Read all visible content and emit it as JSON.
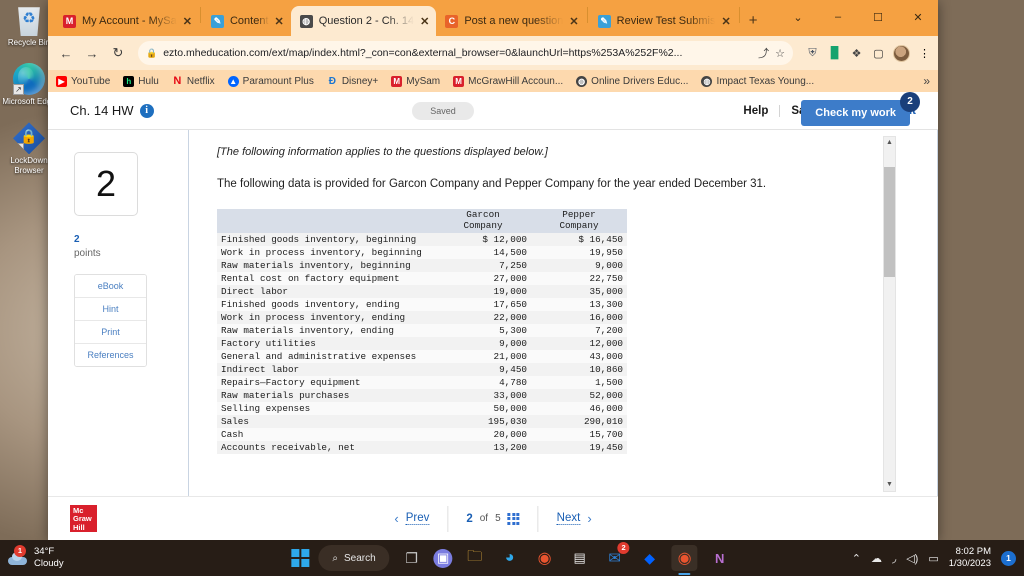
{
  "desktop": {
    "icons": [
      {
        "name": "recycle-bin",
        "label": "Recycle Bin"
      },
      {
        "name": "microsoft-edge",
        "label": "Microsoft Edge"
      },
      {
        "name": "lockdown-browser",
        "label": "LockDown Browser"
      }
    ]
  },
  "browser": {
    "tabs": [
      {
        "title": "My Account - MySa",
        "favicon": "M",
        "favicon_color": "#d9202c",
        "active": false
      },
      {
        "title": "Content",
        "favicon": "✎",
        "favicon_color": "#3aa0d8",
        "active": false
      },
      {
        "title": "Question 2 - Ch. 14",
        "favicon": "⊕",
        "favicon_color": "#4a4a4a",
        "active": true
      },
      {
        "title": "Post a new question",
        "favicon": "C",
        "favicon_color": "#e8632a",
        "active": false
      },
      {
        "title": "Review Test Submis",
        "favicon": "✎",
        "favicon_color": "#3aa0d8",
        "active": false
      }
    ],
    "new_tab_label": "+",
    "window_controls": {
      "restore": "⌄",
      "minimize": "–",
      "maximize": "☐",
      "close": "✕"
    },
    "nav": {
      "back": "←",
      "forward": "→",
      "reload": "↻"
    },
    "omnibox": {
      "lock": "🔒",
      "url": "ezto.mheducation.com/ext/map/index.html?_con=con&external_browser=0&launchUrl=https%253A%252F%2...",
      "share_icon": "⤴",
      "bookmark_star": "☆"
    },
    "extensions": [
      {
        "name": "shield-extension-icon",
        "glyph": "⛨",
        "color": "#4b5563"
      },
      {
        "name": "grammarly-extension-icon",
        "glyph": "▐▌",
        "color": "#15a36e"
      },
      {
        "name": "puzzle-extensions-icon",
        "glyph": "🧩",
        "color": "#444"
      },
      {
        "name": "sidebar-extension-icon",
        "glyph": "◯",
        "color": "#333"
      }
    ],
    "menu_icon": "⋮",
    "bookmarks": [
      {
        "label": "YouTube",
        "mark": "▶",
        "color": "#ff0000"
      },
      {
        "label": "Hulu",
        "mark": "h",
        "color": "#1ce783"
      },
      {
        "label": "Netflix",
        "mark": "N",
        "color": "#e50914"
      },
      {
        "label": "Paramount Plus",
        "mark": "▲",
        "color": "#0064ff"
      },
      {
        "label": "Disney+",
        "mark": "D",
        "color": "#1a75d1"
      },
      {
        "label": "MySam",
        "mark": "M",
        "color": "#d9202c"
      },
      {
        "label": "McGrawHill Accoun...",
        "mark": "M",
        "color": "#d9202c"
      },
      {
        "label": "Online Drivers Educ...",
        "mark": "⊕",
        "color": "#444"
      },
      {
        "label": "Impact Texas Young...",
        "mark": "⊕",
        "color": "#444"
      }
    ],
    "bookmarks_overflow": "»"
  },
  "assignment": {
    "title": "Ch. 14 HW",
    "info_icon_label": "i",
    "save_status": "Saved",
    "actions": [
      {
        "label": "Help"
      },
      {
        "label": "Save & Exit"
      },
      {
        "label": "Submit"
      }
    ],
    "check_my_work": {
      "label": "Check my work",
      "badge": "2"
    }
  },
  "question": {
    "number": "2",
    "points_value": "2",
    "points_label": "points",
    "side_buttons": [
      "eBook",
      "Hint",
      "Print",
      "References"
    ],
    "intro_italic": "[The following information applies to the questions displayed below.]",
    "intro_text": "The following data is provided for Garcon Company and Pepper Company for the year ended December 31."
  },
  "table": {
    "columns": [
      {
        "line1": "Garcon",
        "line2": "Company"
      },
      {
        "line1": "Pepper",
        "line2": "Company"
      }
    ],
    "rows": [
      {
        "label": "Finished goods inventory, beginning",
        "garcon": "$ 12,000",
        "pepper": "$ 16,450"
      },
      {
        "label": "Work in process inventory, beginning",
        "garcon": "14,500",
        "pepper": "19,950"
      },
      {
        "label": "Raw materials inventory, beginning",
        "garcon": "7,250",
        "pepper": "9,000"
      },
      {
        "label": "Rental cost on factory equipment",
        "garcon": "27,000",
        "pepper": "22,750"
      },
      {
        "label": "Direct labor",
        "garcon": "19,000",
        "pepper": "35,000"
      },
      {
        "label": "Finished goods inventory, ending",
        "garcon": "17,650",
        "pepper": "13,300"
      },
      {
        "label": "Work in process inventory, ending",
        "garcon": "22,000",
        "pepper": "16,000"
      },
      {
        "label": "Raw materials inventory, ending",
        "garcon": "5,300",
        "pepper": "7,200"
      },
      {
        "label": "Factory utilities",
        "garcon": "9,000",
        "pepper": "12,000"
      },
      {
        "label": "General and administrative expenses",
        "garcon": "21,000",
        "pepper": "43,000"
      },
      {
        "label": "Indirect labor",
        "garcon": "9,450",
        "pepper": "10,860"
      },
      {
        "label": "Repairs—Factory equipment",
        "garcon": "4,780",
        "pepper": "1,500"
      },
      {
        "label": "Raw materials purchases",
        "garcon": "33,000",
        "pepper": "52,000"
      },
      {
        "label": "Selling expenses",
        "garcon": "50,000",
        "pepper": "46,000"
      },
      {
        "label": "Sales",
        "garcon": "195,030",
        "pepper": "290,010"
      },
      {
        "label": "Cash",
        "garcon": "20,000",
        "pepper": "15,700"
      },
      {
        "label": "Accounts receivable, net",
        "garcon": "13,200",
        "pepper": "19,450"
      }
    ]
  },
  "footer": {
    "logo_line1": "Mc",
    "logo_line2": "Graw",
    "logo_line3": "Hill",
    "prev_label": "Prev",
    "current_page": "2",
    "of_label": "of",
    "total_pages": "5",
    "next_label": "Next",
    "prev_chevron": "‹",
    "next_chevron": "›"
  },
  "taskbar": {
    "weather": {
      "temp": "34°F",
      "condition": "Cloudy",
      "badge": "1"
    },
    "search_placeholder": "Search",
    "apps": [
      {
        "name": "task-view",
        "glyph": "❐",
        "color": "#c8c8c8",
        "badge": ""
      },
      {
        "name": "teams",
        "glyph": "📹",
        "color": "#7b7de0",
        "badge": ""
      },
      {
        "name": "file-explorer",
        "glyph": "📁",
        "color": "#f5bd42",
        "badge": ""
      },
      {
        "name": "microsoft-edge",
        "glyph": "◔",
        "color": "#2ea8ea",
        "badge": ""
      },
      {
        "name": "google-chrome",
        "glyph": "◉",
        "color": "#e8542f",
        "badge": ""
      },
      {
        "name": "microsoft-store",
        "glyph": "🏬",
        "color": "#e8e8e8",
        "badge": ""
      },
      {
        "name": "mail",
        "glyph": "✉",
        "color": "#2f7fd1",
        "badge": "2"
      },
      {
        "name": "dropbox",
        "glyph": "◆",
        "color": "#0061ff",
        "badge": ""
      },
      {
        "name": "google-chrome-active",
        "glyph": "◉",
        "color": "#e8542f",
        "badge": ""
      },
      {
        "name": "onenote",
        "glyph": "N",
        "color": "#7b2f8f",
        "badge": ""
      }
    ],
    "tray": {
      "chevron": "⌃",
      "onedrive": "☁",
      "wifi": "◠",
      "volume": "🔊",
      "battery": "▃",
      "time": "8:02 PM",
      "date": "1/30/2023",
      "notification_badge": "1"
    }
  }
}
